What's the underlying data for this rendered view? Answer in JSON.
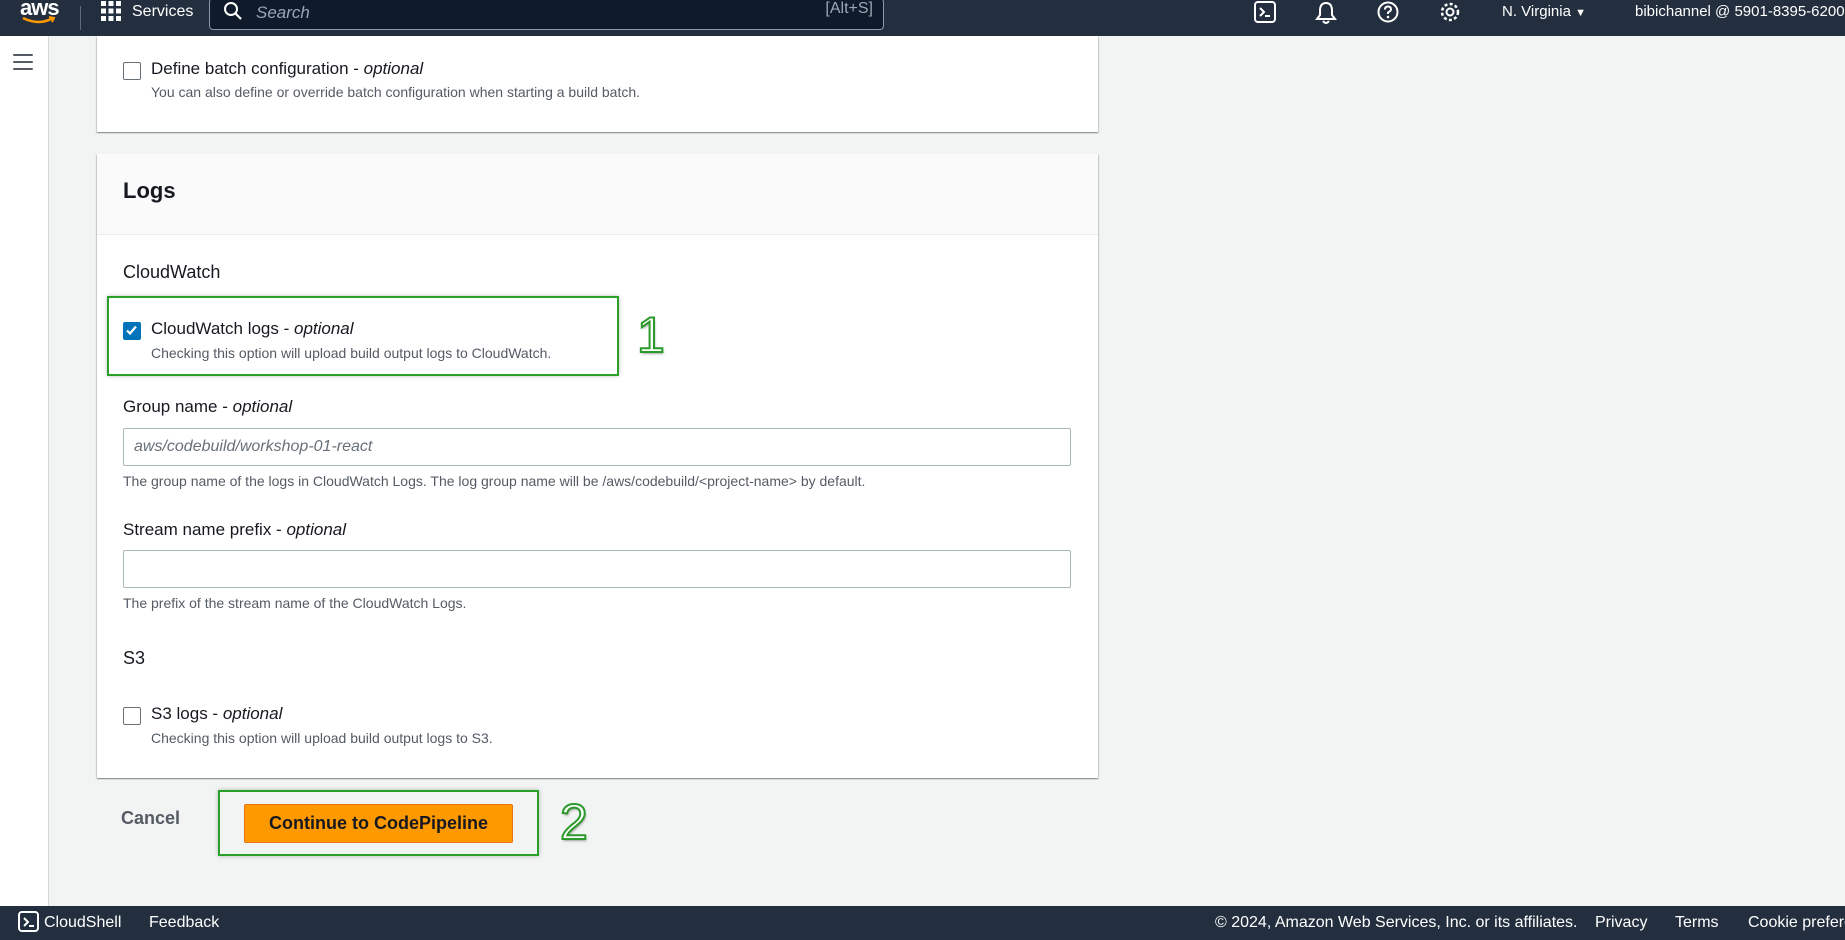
{
  "topnav": {
    "logo_text": "aws",
    "services_label": "Services",
    "search_placeholder": "Search",
    "search_shortcut": "[Alt+S]",
    "region_label": "N. Virginia",
    "account_label": "bibichannel @ 5901-8395-6200"
  },
  "batch": {
    "label": "Define batch configuration - ",
    "label_optional": "optional",
    "description": "You can also define or override batch configuration when starting a build batch.",
    "checked": false
  },
  "logs": {
    "title": "Logs",
    "cloudwatch_section": "CloudWatch",
    "cloudwatch_logs": {
      "label": "CloudWatch logs - ",
      "label_optional": "optional",
      "description": "Checking this option will upload build output logs to CloudWatch.",
      "checked": true
    },
    "group_name": {
      "label": "Group name - ",
      "label_optional": "optional",
      "placeholder": "aws/codebuild/workshop-01-react",
      "value": "",
      "hint": "The group name of the logs in CloudWatch Logs. The log group name will be /aws/codebuild/<project-name> by default."
    },
    "stream_prefix": {
      "label": "Stream name prefix - ",
      "label_optional": "optional",
      "placeholder": "",
      "value": "",
      "hint": "The prefix of the stream name of the CloudWatch Logs."
    },
    "s3_section": "S3",
    "s3_logs": {
      "label": "S3 logs - ",
      "label_optional": "optional",
      "description": "Checking this option will upload build output logs to S3.",
      "checked": false
    }
  },
  "actions": {
    "cancel_label": "Cancel",
    "continue_label": "Continue to CodePipeline"
  },
  "annotations": {
    "step1": "1",
    "step2": "2"
  },
  "footer": {
    "cloudshell_label": "CloudShell",
    "feedback_label": "Feedback",
    "copyright": "© 2024, Amazon Web Services, Inc. or its affiliates.",
    "privacy_label": "Privacy",
    "terms_label": "Terms",
    "cookie_label": "Cookie preferences"
  },
  "colors": {
    "nav_bg": "#232f3e",
    "primary": "#ff9900",
    "checkbox_checked": "#0073bb",
    "annotation": "#2aa02a"
  }
}
